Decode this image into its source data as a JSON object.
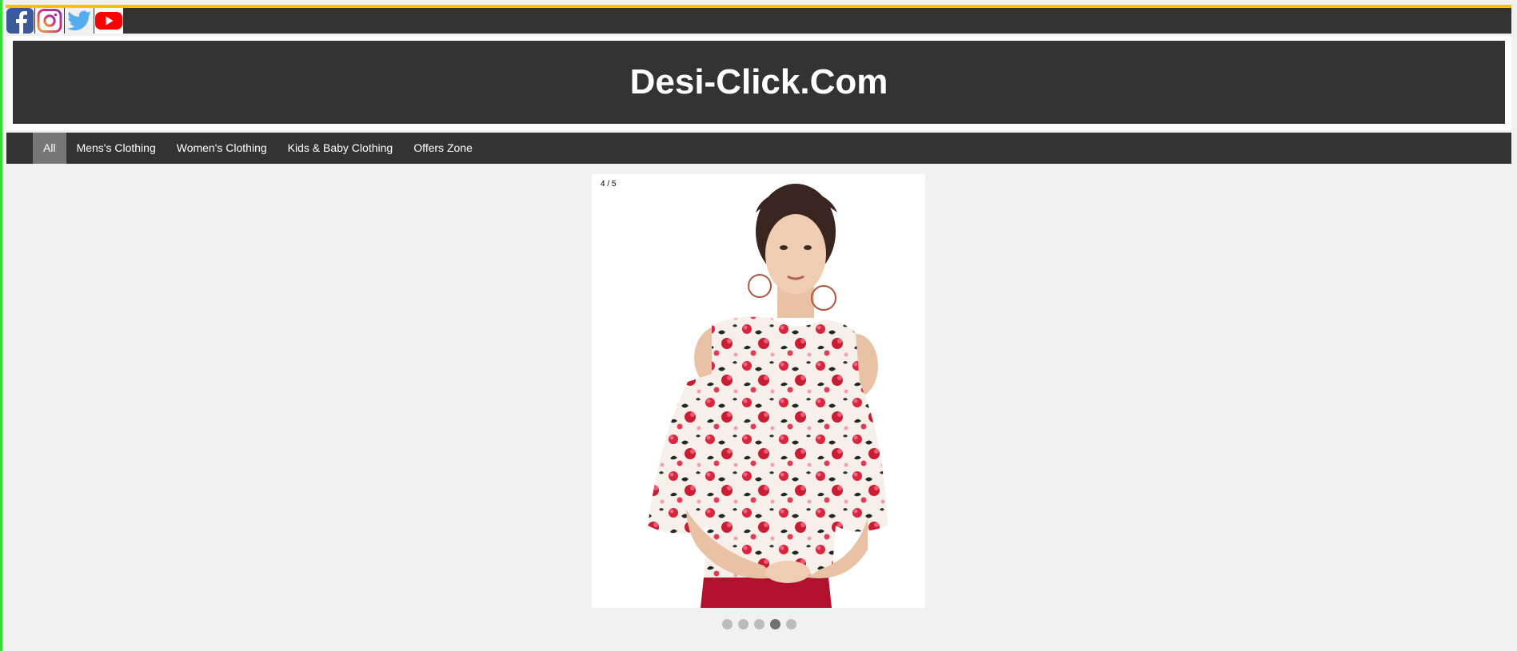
{
  "colors": {
    "accent_top": "#f2c200",
    "dark_bar": "#333333",
    "nav_active": "#777777",
    "page_bg": "#f1f1f1",
    "dot": "#bbbbbb",
    "dot_active": "#717171"
  },
  "social": [
    {
      "icon": "facebook-icon"
    },
    {
      "icon": "instagram-icon"
    },
    {
      "icon": "twitter-icon"
    },
    {
      "icon": "youtube-icon"
    }
  ],
  "banner": {
    "title": "Desi-Click.Com"
  },
  "nav": {
    "items": [
      {
        "label": "All",
        "active": true
      },
      {
        "label": "Mens's Clothing"
      },
      {
        "label": "Women's Clothing"
      },
      {
        "label": "Kids & Baby Clothing"
      },
      {
        "label": "Offers Zone"
      }
    ]
  },
  "slideshow": {
    "counter": "4 / 5",
    "current": 4,
    "total": 5,
    "image": "woman-floral-cold-shoulder-top"
  }
}
